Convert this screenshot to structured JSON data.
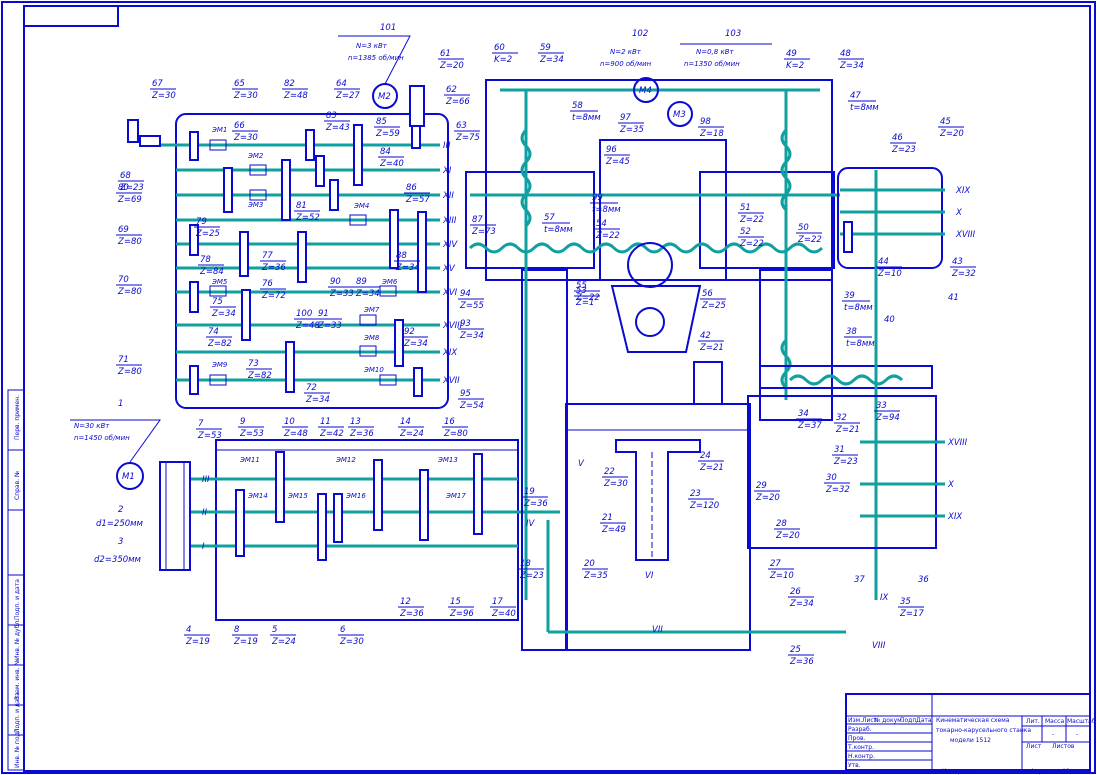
{
  "motors": [
    {
      "id": "101",
      "name": "M2",
      "power": "N=3 кВт",
      "speed": "n=1385 об/мин"
    },
    {
      "id": "102",
      "name": "M4",
      "power": "N=2 кВт",
      "speed": "n=900 об/мин"
    },
    {
      "id": "103",
      "name": "M3",
      "power": "N=0,8 кВт",
      "speed": "n=1350 об/мин"
    },
    {
      "id": "1",
      "name": "M1",
      "power": "N=30 кВт",
      "speed": "n=1450 об/мин"
    }
  ],
  "pulleys": [
    {
      "id": "2",
      "text": "d1=250мм"
    },
    {
      "id": "3",
      "text": "d2=350мм"
    }
  ],
  "gears": [
    {
      "id": "4",
      "z": "Z=19"
    },
    {
      "id": "5",
      "z": "Z=24"
    },
    {
      "id": "6",
      "z": "Z=30"
    },
    {
      "id": "7",
      "z": "Z=53"
    },
    {
      "id": "8",
      "z": "Z=19"
    },
    {
      "id": "9",
      "z": "Z=53"
    },
    {
      "id": "10",
      "z": "Z=48"
    },
    {
      "id": "11",
      "z": "Z=42"
    },
    {
      "id": "12",
      "z": "Z=36"
    },
    {
      "id": "13",
      "z": "Z=36"
    },
    {
      "id": "14",
      "z": "Z=24"
    },
    {
      "id": "15",
      "z": "Z=96"
    },
    {
      "id": "16",
      "z": "Z=80"
    },
    {
      "id": "17",
      "z": "Z=40"
    },
    {
      "id": "18",
      "z": "Z=23"
    },
    {
      "id": "19",
      "z": "Z=36"
    },
    {
      "id": "20",
      "z": "Z=35"
    },
    {
      "id": "21",
      "z": "Z=49"
    },
    {
      "id": "22",
      "z": "Z=30"
    },
    {
      "id": "23",
      "z": "Z=120"
    },
    {
      "id": "24",
      "z": "Z=21"
    },
    {
      "id": "25",
      "z": "Z=36"
    },
    {
      "id": "26",
      "z": "Z=34"
    },
    {
      "id": "27",
      "z": "Z=10"
    },
    {
      "id": "28",
      "z": "Z=20"
    },
    {
      "id": "29",
      "z": "Z=20"
    },
    {
      "id": "30",
      "z": "Z=32"
    },
    {
      "id": "31",
      "z": "Z=23"
    },
    {
      "id": "32",
      "z": "Z=21"
    },
    {
      "id": "33",
      "z": "Z=94"
    },
    {
      "id": "34",
      "z": "Z=37"
    },
    {
      "id": "35",
      "z": "Z=17"
    },
    {
      "id": "42",
      "z": "Z=21"
    },
    {
      "id": "43",
      "z": "Z=32"
    },
    {
      "id": "44",
      "z": "Z=10"
    },
    {
      "id": "45",
      "z": "Z=20"
    },
    {
      "id": "46",
      "z": "Z=23"
    },
    {
      "id": "48",
      "z": "Z=34"
    },
    {
      "id": "49",
      "z": "K=2"
    },
    {
      "id": "50",
      "z": "Z=22"
    },
    {
      "id": "51",
      "z": "Z=22"
    },
    {
      "id": "52",
      "z": "Z=22"
    },
    {
      "id": "53",
      "z": "Z=1"
    },
    {
      "id": "54",
      "z": "Z=22"
    },
    {
      "id": "55",
      "z": "Z=22"
    },
    {
      "id": "56",
      "z": "Z=25"
    },
    {
      "id": "59",
      "z": "Z=34"
    },
    {
      "id": "60",
      "z": "K=2"
    },
    {
      "id": "61",
      "z": "Z=20"
    },
    {
      "id": "62",
      "z": "Z=66"
    },
    {
      "id": "63",
      "z": "Z=75"
    },
    {
      "id": "64",
      "z": "Z=27"
    },
    {
      "id": "65",
      "z": "Z=30"
    },
    {
      "id": "66",
      "z": "Z=30"
    },
    {
      "id": "67",
      "z": "Z=30"
    },
    {
      "id": "68",
      "z": "Z=23"
    },
    {
      "id": "69",
      "z": "Z=80"
    },
    {
      "id": "70",
      "z": "Z=80"
    },
    {
      "id": "71",
      "z": "Z=80"
    },
    {
      "id": "72",
      "z": "Z=34"
    },
    {
      "id": "73",
      "z": "Z=82"
    },
    {
      "id": "74",
      "z": "Z=82"
    },
    {
      "id": "75",
      "z": "Z=34"
    },
    {
      "id": "76",
      "z": "Z=72"
    },
    {
      "id": "77",
      "z": "Z=36"
    },
    {
      "id": "78",
      "z": "Z=84"
    },
    {
      "id": "79",
      "z": "Z=25"
    },
    {
      "id": "80",
      "z": "Z=69"
    },
    {
      "id": "81",
      "z": "Z=52"
    },
    {
      "id": "82",
      "z": "Z=48"
    },
    {
      "id": "83",
      "z": "Z=43"
    },
    {
      "id": "84",
      "z": "Z=40"
    },
    {
      "id": "85",
      "z": "Z=59"
    },
    {
      "id": "86",
      "z": "Z=57"
    },
    {
      "id": "87",
      "z": "Z=73"
    },
    {
      "id": "88",
      "z": "Z=34"
    },
    {
      "id": "89",
      "z": "Z=34"
    },
    {
      "id": "90",
      "z": "Z=33"
    },
    {
      "id": "91",
      "z": "Z=33"
    },
    {
      "id": "92",
      "z": "Z=34"
    },
    {
      "id": "93",
      "z": "Z=34"
    },
    {
      "id": "94",
      "z": "Z=55"
    },
    {
      "id": "95",
      "z": "Z=54"
    },
    {
      "id": "96",
      "z": "Z=45"
    },
    {
      "id": "97",
      "z": "Z=35"
    },
    {
      "id": "98",
      "z": "Z=18"
    },
    {
      "id": "100",
      "z": "Z=48"
    }
  ],
  "screws": [
    {
      "id": "38",
      "t": "t=8мм"
    },
    {
      "id": "39",
      "t": "t=8мм"
    },
    {
      "id": "47",
      "t": "t=8мм"
    },
    {
      "id": "57",
      "t": "t=8мм"
    },
    {
      "id": "58",
      "t": "t=8мм"
    },
    {
      "id": "99",
      "t": "t=8мм"
    }
  ],
  "loose_labels": [
    "36",
    "37",
    "40",
    "41"
  ],
  "clutches": [
    "ЭМ1",
    "ЭМ2",
    "ЭМ3",
    "ЭМ4",
    "ЭМ5",
    "ЭМ6",
    "ЭМ7",
    "ЭМ8",
    "ЭМ9",
    "ЭМ10",
    "ЭМ11",
    "ЭМ12",
    "ЭМ13",
    "ЭМ14",
    "ЭМ15",
    "ЭМ16",
    "ЭМ17"
  ],
  "shafts_left_upper": [
    "III",
    "XI",
    "XII",
    "XIII",
    "XIV",
    "XV",
    "XVI",
    "XVIII",
    "XIX",
    "XVII"
  ],
  "shafts_left_lower": [
    "III",
    "II",
    "I"
  ],
  "shafts_apron": [
    "XIX",
    "X",
    "XVIII"
  ],
  "shafts_feed": [
    "XVIII",
    "X",
    "XIX"
  ],
  "shafts_misc": [
    "IV",
    "V",
    "VI",
    "VII",
    "VIII",
    "IX"
  ],
  "title_block": {
    "title_line1": "Кинематическая схема",
    "title_line2": "токарно-карусельного станка",
    "title_line3": "модели 1512",
    "col_lit": "Лит.",
    "col_mass": "Масса",
    "col_scale": "Масштаб",
    "sheet": "Лист",
    "sheets": "Листов",
    "rows": [
      "Изм.",
      "Лист",
      "№ докум.",
      "Подп.",
      "Дата"
    ],
    "roles": [
      "Разраб.",
      "Пров.",
      "Т.контр.",
      "Н.контр.",
      "Утв."
    ],
    "dash": "-",
    "copied": "Копировал",
    "format": "Формат",
    "format_value": "А1"
  },
  "side_stamp": [
    "Перв. примен.",
    "Справ. №",
    "Подп. и дата",
    "Инв. № дубл.",
    "Взам. инв. №",
    "Подп. и дата",
    "Инв. № подл."
  ]
}
